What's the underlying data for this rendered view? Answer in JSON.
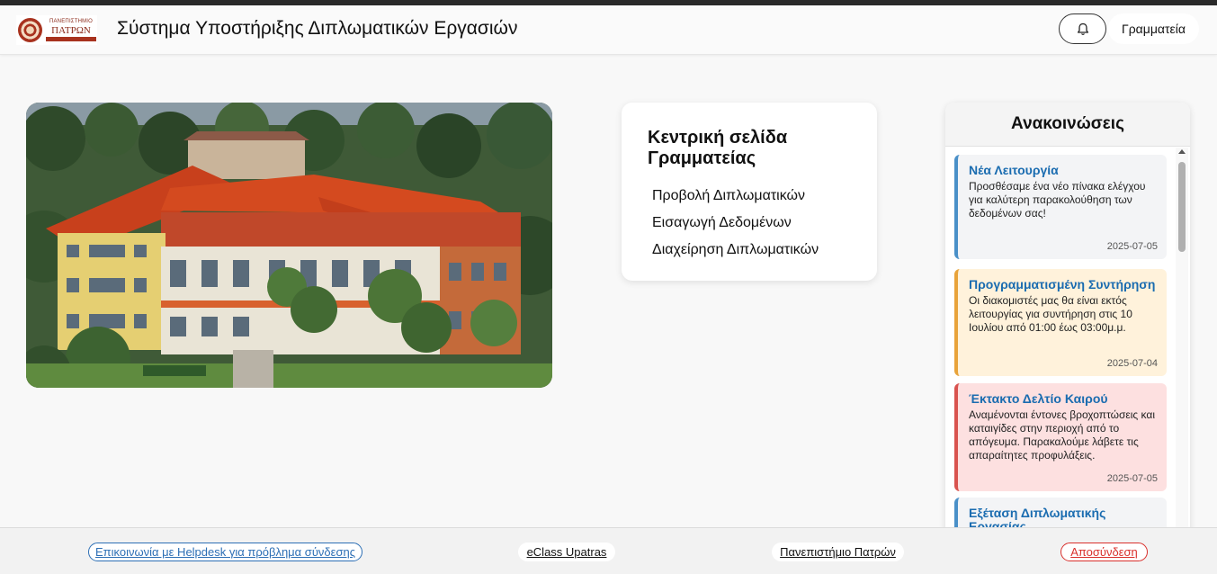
{
  "header": {
    "logo": {
      "line1": "ΠΑΝΕΠΙΣΤΗΜΙΟ",
      "line2": "ΠΑΤΡΩΝ"
    },
    "title": "Σύστημα Υποστήριξης Διπλωματικών Εργασιών",
    "user_label": "Γραμματεία",
    "notification_icon": "bell-icon"
  },
  "main": {
    "image_subject": "campus-building",
    "card": {
      "title": "Κεντρική σελίδα Γραμματείας",
      "links": [
        {
          "label": "Προβολή Διπλωματικών"
        },
        {
          "label": "Εισαγωγή Δεδομένων"
        },
        {
          "label": "Διαχείρηση Διπλωματικών"
        }
      ]
    }
  },
  "announcements": {
    "title": "Ανακοινώσεις",
    "items": [
      {
        "title": "Νέα Λειτουργία",
        "body": "Προσθέσαμε ένα νέο πίνακα ελέγχου για καλύτερη παρακολούθηση των δεδομένων σας!",
        "date": "2025-07-05",
        "bg": "#f3f4f6",
        "accent": "#4a90c8"
      },
      {
        "title": "Προγραμματισμένη Συντήρηση",
        "body": "Οι διακομιστές μας θα είναι εκτός λειτουργίας για συντήρηση στις 10 Ιουλίου από 01:00 έως 03:00μ.μ.",
        "date": "2025-07-04",
        "bg": "#fff2db",
        "accent": "#e8a33a"
      },
      {
        "title": "Έκτακτο Δελτίο Καιρού",
        "body": "Αναμένονται έντονες βροχοπτώσεις και καταιγίδες στην περιοχή από το απόγευμα. Παρακαλούμε λάβετε τις απαραίτητες προφυλάξεις.",
        "date": "2025-07-05",
        "bg": "#fde0e0",
        "accent": "#d9534f"
      },
      {
        "title": "Εξέταση Διπλωματικής Εργασίας",
        "body": "",
        "date": "",
        "bg": "#f3f4f6",
        "accent": "#4a90c8"
      }
    ]
  },
  "footer": {
    "helpdesk": "Επικοινωνία με Helpdesk για πρόβλημα σύνδεσης",
    "eclass": "eClass Upatras",
    "university": "Πανεπιστήμιο Πατρών",
    "logout": "Αποσύνδεση",
    "colors": {
      "helpdesk_border": "#2d6fb5",
      "logout_border": "#d9302c"
    }
  }
}
